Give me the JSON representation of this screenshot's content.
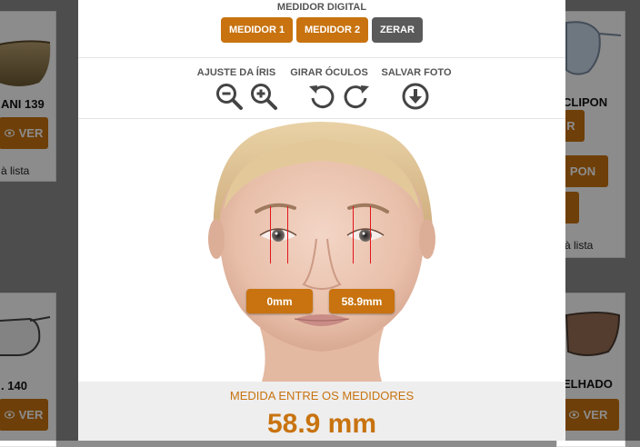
{
  "background": {
    "left_cards": [
      {
        "title": "ANI 139",
        "button": "VER",
        "link": "à lista"
      },
      {
        "title": "140",
        "button": "VER"
      }
    ],
    "right_cards": [
      {
        "title": "CLIPON",
        "buttons": [
          "R",
          "PON",
          ""
        ],
        "link": "à lista"
      },
      {
        "title": "ELHADO",
        "button": "VER"
      }
    ],
    "title_prefix_dot": "."
  },
  "modal": {
    "title": "MEDIDOR DIGITAL",
    "buttons": {
      "medidor1": "MEDIDOR 1",
      "medidor2": "MEDIDOR 2",
      "zerar": "ZERAR"
    },
    "tools": {
      "iris_label": "AJUSTE DA ÍRIS",
      "rotate_label": "GIRAR ÓCULOS",
      "save_label": "SALVAR FOTO"
    },
    "measure_left": "0mm",
    "measure_right": "58.9mm",
    "result_label": "MEDIDA ENTRE OS MEDIDORES",
    "result_value": "58.9 mm"
  },
  "colors": {
    "accent": "#c8730f",
    "zerar": "#5a5a5a",
    "marker": "#e4151b"
  },
  "icons": [
    "zoom-out-icon",
    "zoom-in-icon",
    "rotate-left-icon",
    "rotate-right-icon",
    "download-icon",
    "eye-icon"
  ]
}
